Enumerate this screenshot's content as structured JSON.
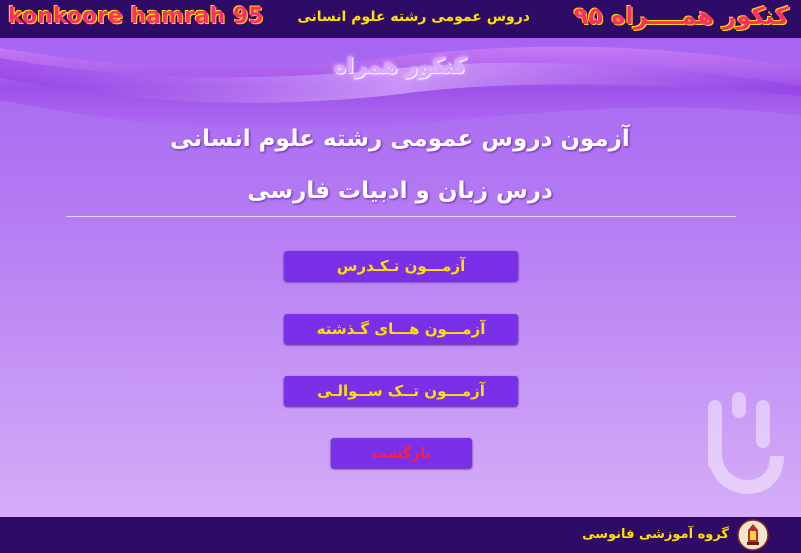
{
  "header": {
    "title_fa": "کنکور همــــراه ۹۵",
    "title_en": "konkoore hamrah 95",
    "subtitle": "دروس عمومی رشته علوم انسانی"
  },
  "ribbon": {
    "label": "کنکور همراه"
  },
  "main": {
    "heading1": "آزمون دروس عمومی رشته علوم انسانی",
    "heading2": "درس زبان و ادبیات فارسی",
    "buttons": [
      {
        "label": "آزمـــون تـکـدرس"
      },
      {
        "label": "آزمـــون هـــای گـذشته"
      },
      {
        "label": "آزمـــون تــک ســوالـی"
      }
    ],
    "back_label": "بازگشت"
  },
  "footer": {
    "text": "گروه آموزشی فانوسی"
  },
  "icons": {
    "logo": "lantern-logo-icon",
    "watermark": "bazaar-watermark-icon"
  },
  "colors": {
    "bar": "#2e0b66",
    "button": "#7a2fe8",
    "button_text": "#ffe000",
    "back_text": "#ff1e3c",
    "title": "#ff2b6a"
  }
}
